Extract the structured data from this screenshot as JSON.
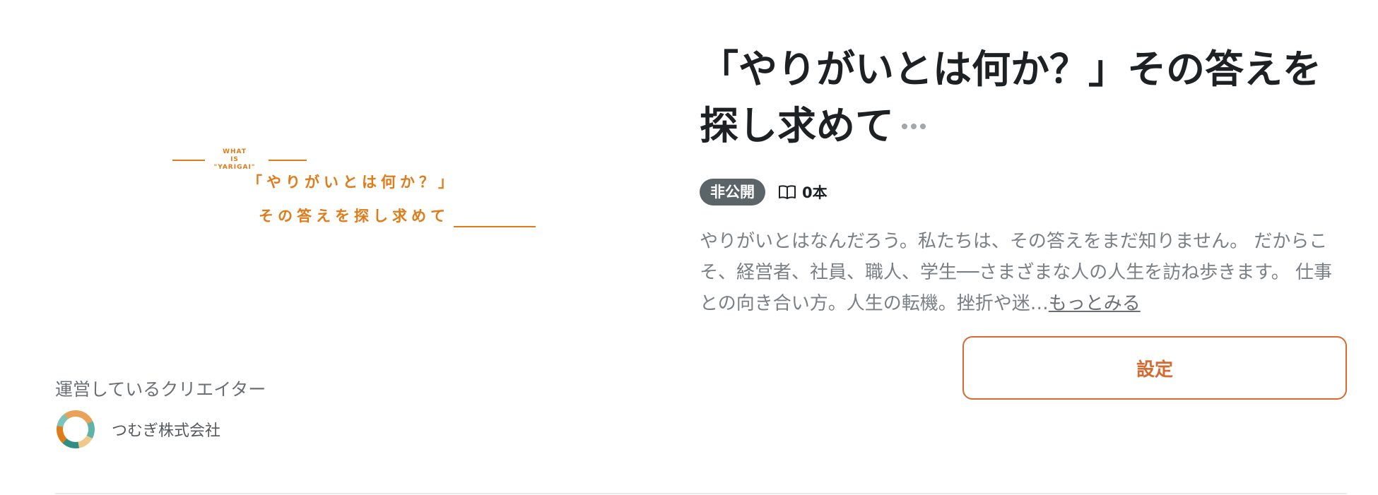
{
  "cover": {
    "small_lines": [
      "WHAT",
      "IS",
      "\"YARIGAI\""
    ],
    "title_line1": "「やりがいとは何か？」",
    "title_line2": "その答えを探し求めて",
    "accent_color": "#e07b1a"
  },
  "creator": {
    "heading": "運営しているクリエイター",
    "name": "つむぎ株式会社",
    "avatar_icon": "wreath-logo-icon"
  },
  "magazine": {
    "title": "「やりがいとは何か？」その答えを探し求めて",
    "more_icon": "ellipsis-icon",
    "status_badge": "非公開",
    "count_icon": "book-icon",
    "article_count": "0本",
    "description": "やりがいとはなんだろう。私たちは、その答えをまだ知りません。 だからこそ、経営者、社員、職人、学生──さまざまな人の人生を訪ね歩きます。 仕事との向き合い方。人生の転機。挫折や迷…",
    "more_link": "もっとみる",
    "settings_button": "設定",
    "button_color": "#d66a32"
  }
}
